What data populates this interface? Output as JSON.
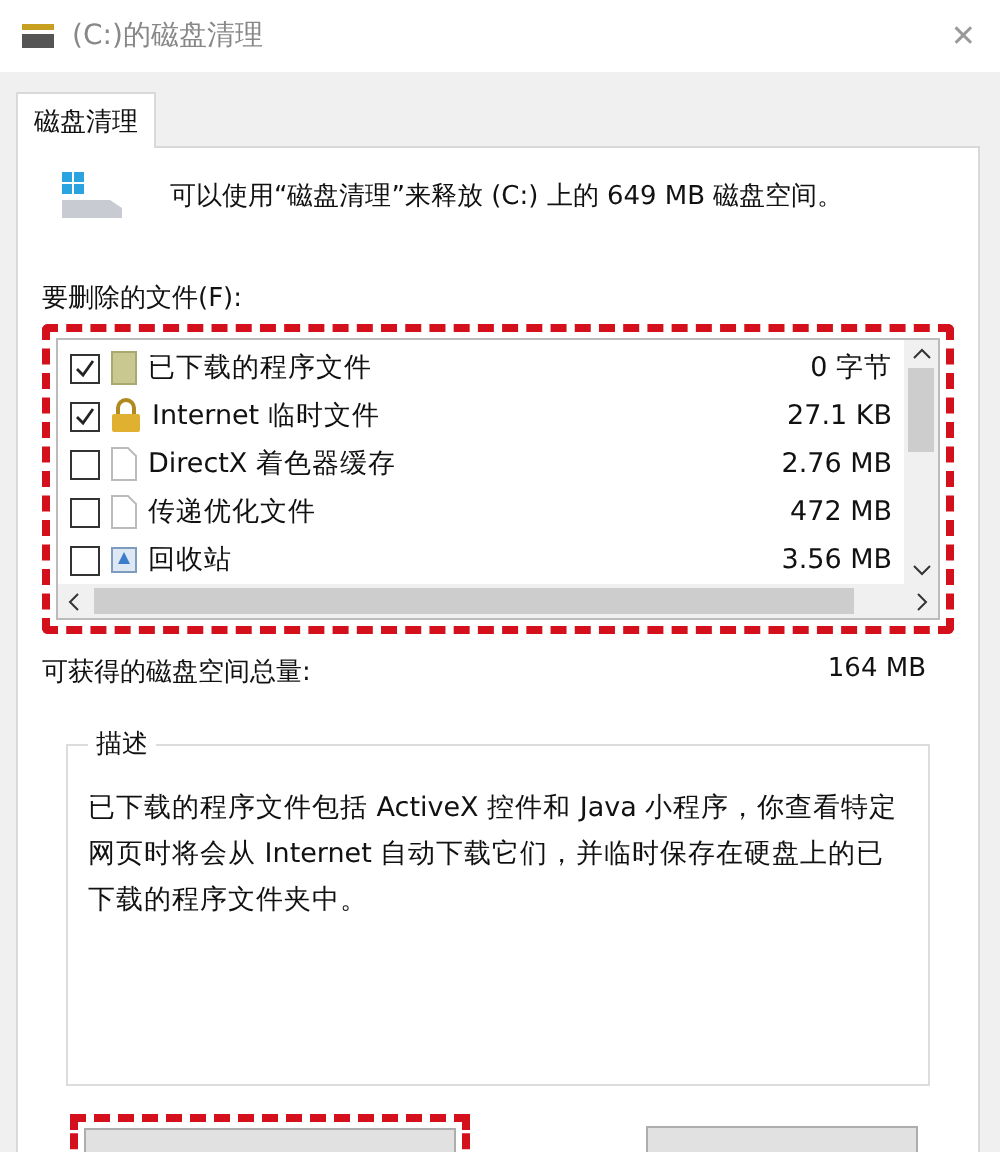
{
  "window": {
    "title": "(C:)的磁盘清理",
    "close": "✕"
  },
  "tabs": [
    {
      "label": "磁盘清理",
      "selected": true
    }
  ],
  "summary": "可以使用“磁盘清理”来释放  (C:) 上的 649 MB 磁盘空间。",
  "files_label": "要删除的文件(F):",
  "files": [
    {
      "kind": "folder",
      "name": "已下载的程序文件",
      "size": "0 字节",
      "checked": true
    },
    {
      "kind": "lock",
      "name": "Internet 临时文件",
      "size": "27.1 KB",
      "checked": true
    },
    {
      "kind": "page",
      "name": "DirectX 着色器缓存",
      "size": "2.76 MB",
      "checked": false
    },
    {
      "kind": "page",
      "name": "传递优化文件",
      "size": "472 MB",
      "checked": false
    },
    {
      "kind": "bin",
      "name": "回收站",
      "size": "3.56 MB",
      "checked": false
    }
  ],
  "total": {
    "label": "可获得的磁盘空间总量:",
    "value": "164 MB"
  },
  "description": {
    "title": "描述",
    "text": "已下载的程序文件包括 ActiveX 控件和 Java 小程序，你查看特定网页时将会从 Internet 自动下载它们，并临时保存在硬盘上的已下载的程序文件夹中。"
  }
}
